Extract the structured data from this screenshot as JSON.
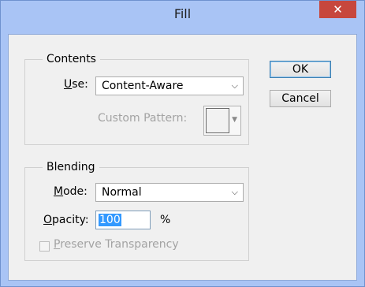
{
  "window": {
    "title": "Fill",
    "close_glyph": "✕"
  },
  "buttons": {
    "ok": "OK",
    "cancel": "Cancel"
  },
  "contents": {
    "legend": "Contents",
    "use_label_u": "U",
    "use_label_rest": "se:",
    "use_value": "Content-Aware",
    "custom_pattern_label": "Custom Pattern:"
  },
  "blending": {
    "legend": "Blending",
    "mode_label_u": "M",
    "mode_label_rest": "ode:",
    "mode_value": "Normal",
    "opacity_label_u": "O",
    "opacity_label_rest": "pacity:",
    "opacity_value": "100",
    "opacity_unit": "%",
    "preserve_label_u": "P",
    "preserve_label_rest": "reserve Transparency",
    "preserve_checked": false
  },
  "icons": {
    "dropdown": "chevron-down-icon",
    "close": "close-icon"
  }
}
